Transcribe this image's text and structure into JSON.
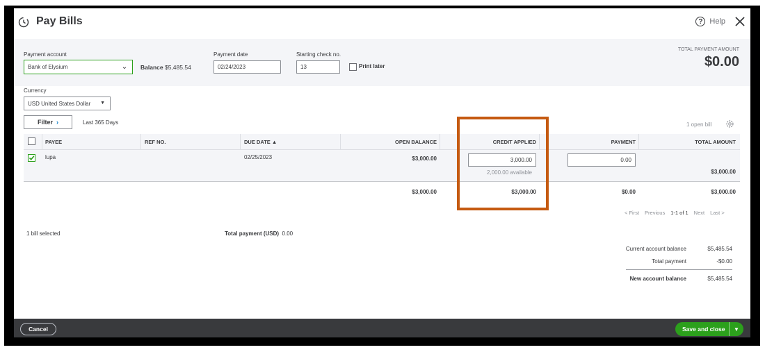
{
  "header": {
    "title": "Pay Bills",
    "help_label": "Help"
  },
  "form": {
    "payment_account_label": "Payment account",
    "payment_account_value": "Bank of Elysium",
    "balance_label": "Balance",
    "balance_value": "$5,485.54",
    "payment_date_label": "Payment date",
    "payment_date_value": "02/24/2023",
    "starting_check_label": "Starting check no.",
    "starting_check_value": "13",
    "print_later_label": "Print later",
    "total_payment_amount_label": "TOTAL PAYMENT AMOUNT",
    "total_payment_amount_value": "$0.00",
    "currency_label": "Currency",
    "currency_value": "USD United States Dollar"
  },
  "table": {
    "filter_label": "Filter",
    "filter_range": "Last 365 Days",
    "open_bills_label": "1 open bill",
    "columns": [
      "PAYEE",
      "REF NO.",
      "DUE DATE",
      "OPEN BALANCE",
      "CREDIT APPLIED",
      "PAYMENT",
      "TOTAL AMOUNT"
    ],
    "rows": [
      {
        "payee": "lupa",
        "ref_no": "",
        "due_date": "02/25/2023",
        "open_balance": "$3,000.00",
        "credit_applied": "3,000.00",
        "credit_available": "2,000.00 available",
        "payment": "0.00",
        "total_amount": "$3,000.00"
      }
    ],
    "totals": {
      "open_balance": "$3,000.00",
      "credit_applied": "$3,000.00",
      "payment": "$0.00",
      "total_amount": "$3,000.00"
    }
  },
  "pagination": {
    "first": "< First",
    "previous": "Previous",
    "range": "1-1 of 1",
    "next": "Next",
    "last": "Last >"
  },
  "summary": {
    "bills_selected": "1 bill selected",
    "total_payment_label": "Total payment  (USD)",
    "total_payment_value": "0.00",
    "current_balance_label": "Current account balance",
    "current_balance_value": "$5,485.54",
    "total_payment_row_label": "Total payment",
    "total_payment_row_value": "-$0.00",
    "new_balance_label": "New account balance",
    "new_balance_value": "$5,485.54"
  },
  "footer": {
    "cancel_label": "Cancel",
    "save_label": "Save and close"
  },
  "colors": {
    "brand_green": "#2ca01c",
    "footer_bg": "#393a3d",
    "highlight": "#c55a11"
  }
}
